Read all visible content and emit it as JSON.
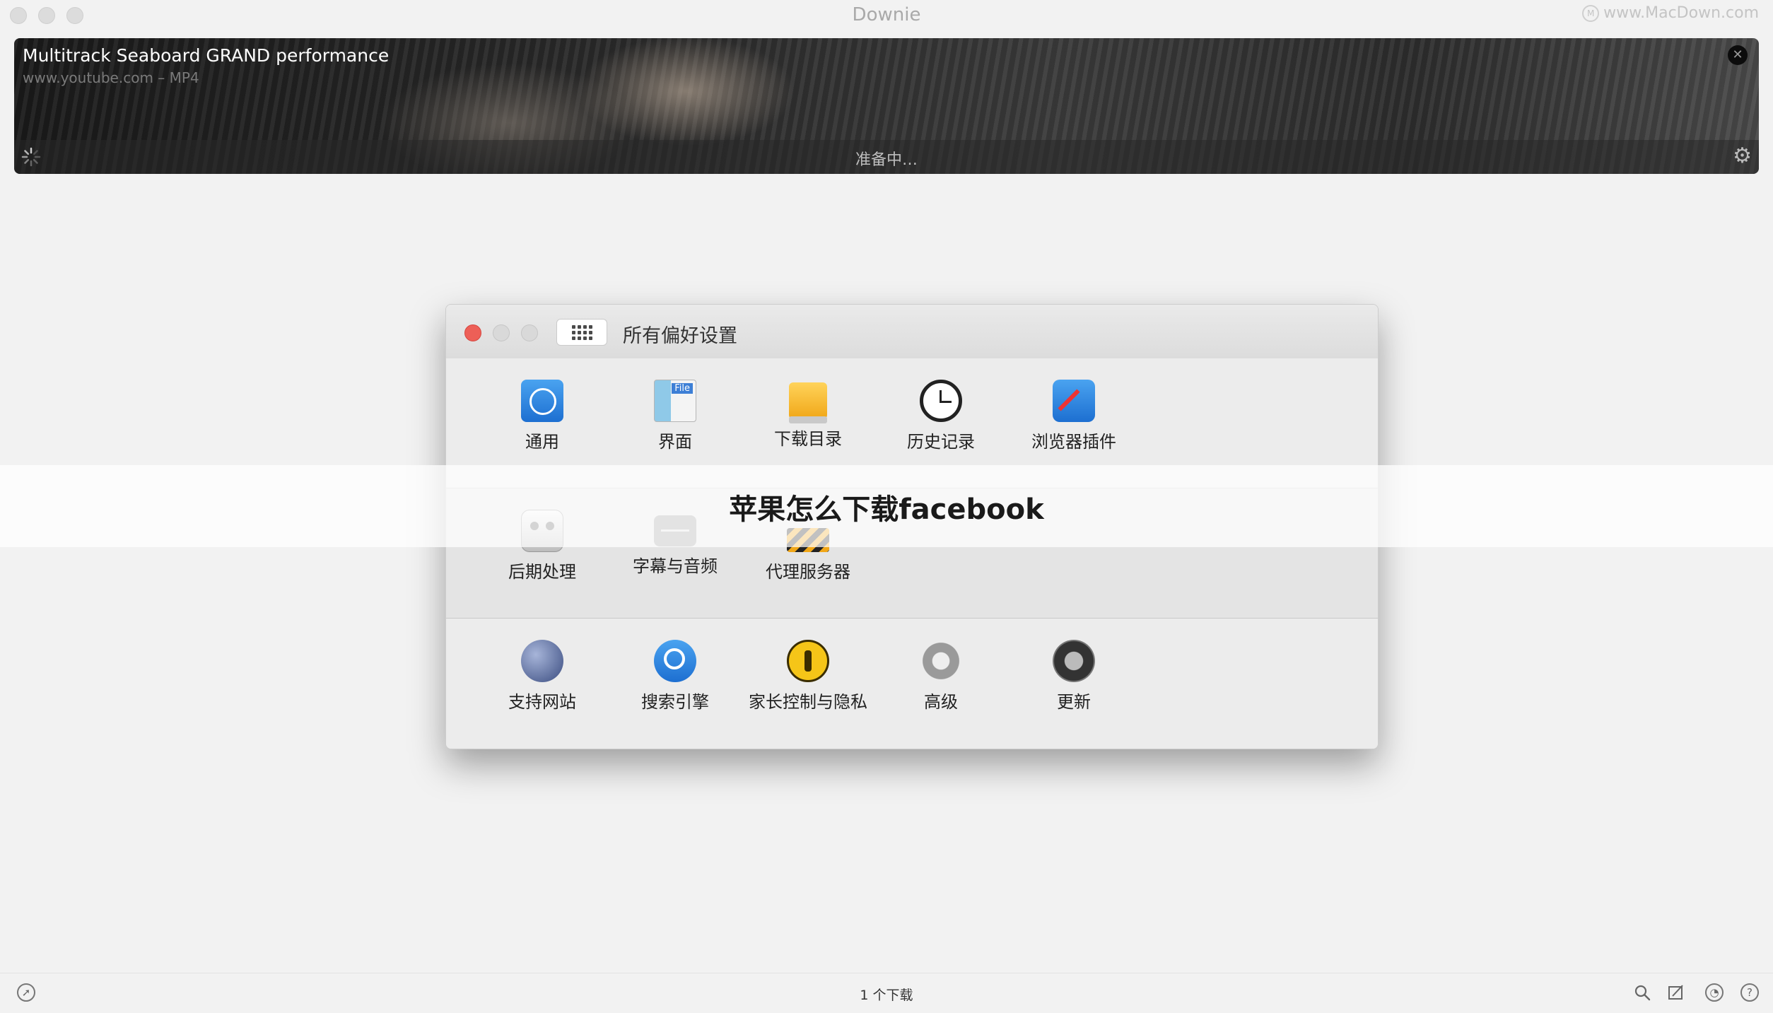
{
  "window": {
    "app_title": "Downie",
    "watermark": "www.MacDown.com",
    "watermark_logo": "M"
  },
  "download": {
    "title": "Multitrack Seaboard GRAND performance",
    "source": "www.youtube.com – MP4",
    "status": "准备中…",
    "close_glyph": "✕",
    "gear_glyph": "⚙"
  },
  "preferences": {
    "title": "所有偏好设置",
    "rows": [
      [
        {
          "label": "通用",
          "icon": "general-gear-icon"
        },
        {
          "label": "界面",
          "icon": "interface-file-icon",
          "tag": "File"
        },
        {
          "label": "下载目录",
          "icon": "folder-drive-icon"
        },
        {
          "label": "历史记录",
          "icon": "clock-icon"
        },
        {
          "label": "浏览器插件",
          "icon": "puzzle-compass-icon"
        }
      ],
      [
        {
          "label": "后期处理",
          "icon": "robot-icon"
        },
        {
          "label": "字幕与音频",
          "icon": "subtitle-icon"
        },
        {
          "label": "代理服务器",
          "icon": "proxy-lock-icon"
        }
      ],
      [
        {
          "label": "支持网站",
          "icon": "globe-icon"
        },
        {
          "label": "搜索引擎",
          "icon": "search-icon"
        },
        {
          "label": "家长控制与隐私",
          "icon": "parental-control-icon"
        },
        {
          "label": "高级",
          "icon": "advanced-gear-icon"
        },
        {
          "label": "更新",
          "icon": "update-icon"
        }
      ]
    ]
  },
  "banner": {
    "text": "苹果怎么下载facebook"
  },
  "bottom": {
    "count": "1 个下载"
  }
}
